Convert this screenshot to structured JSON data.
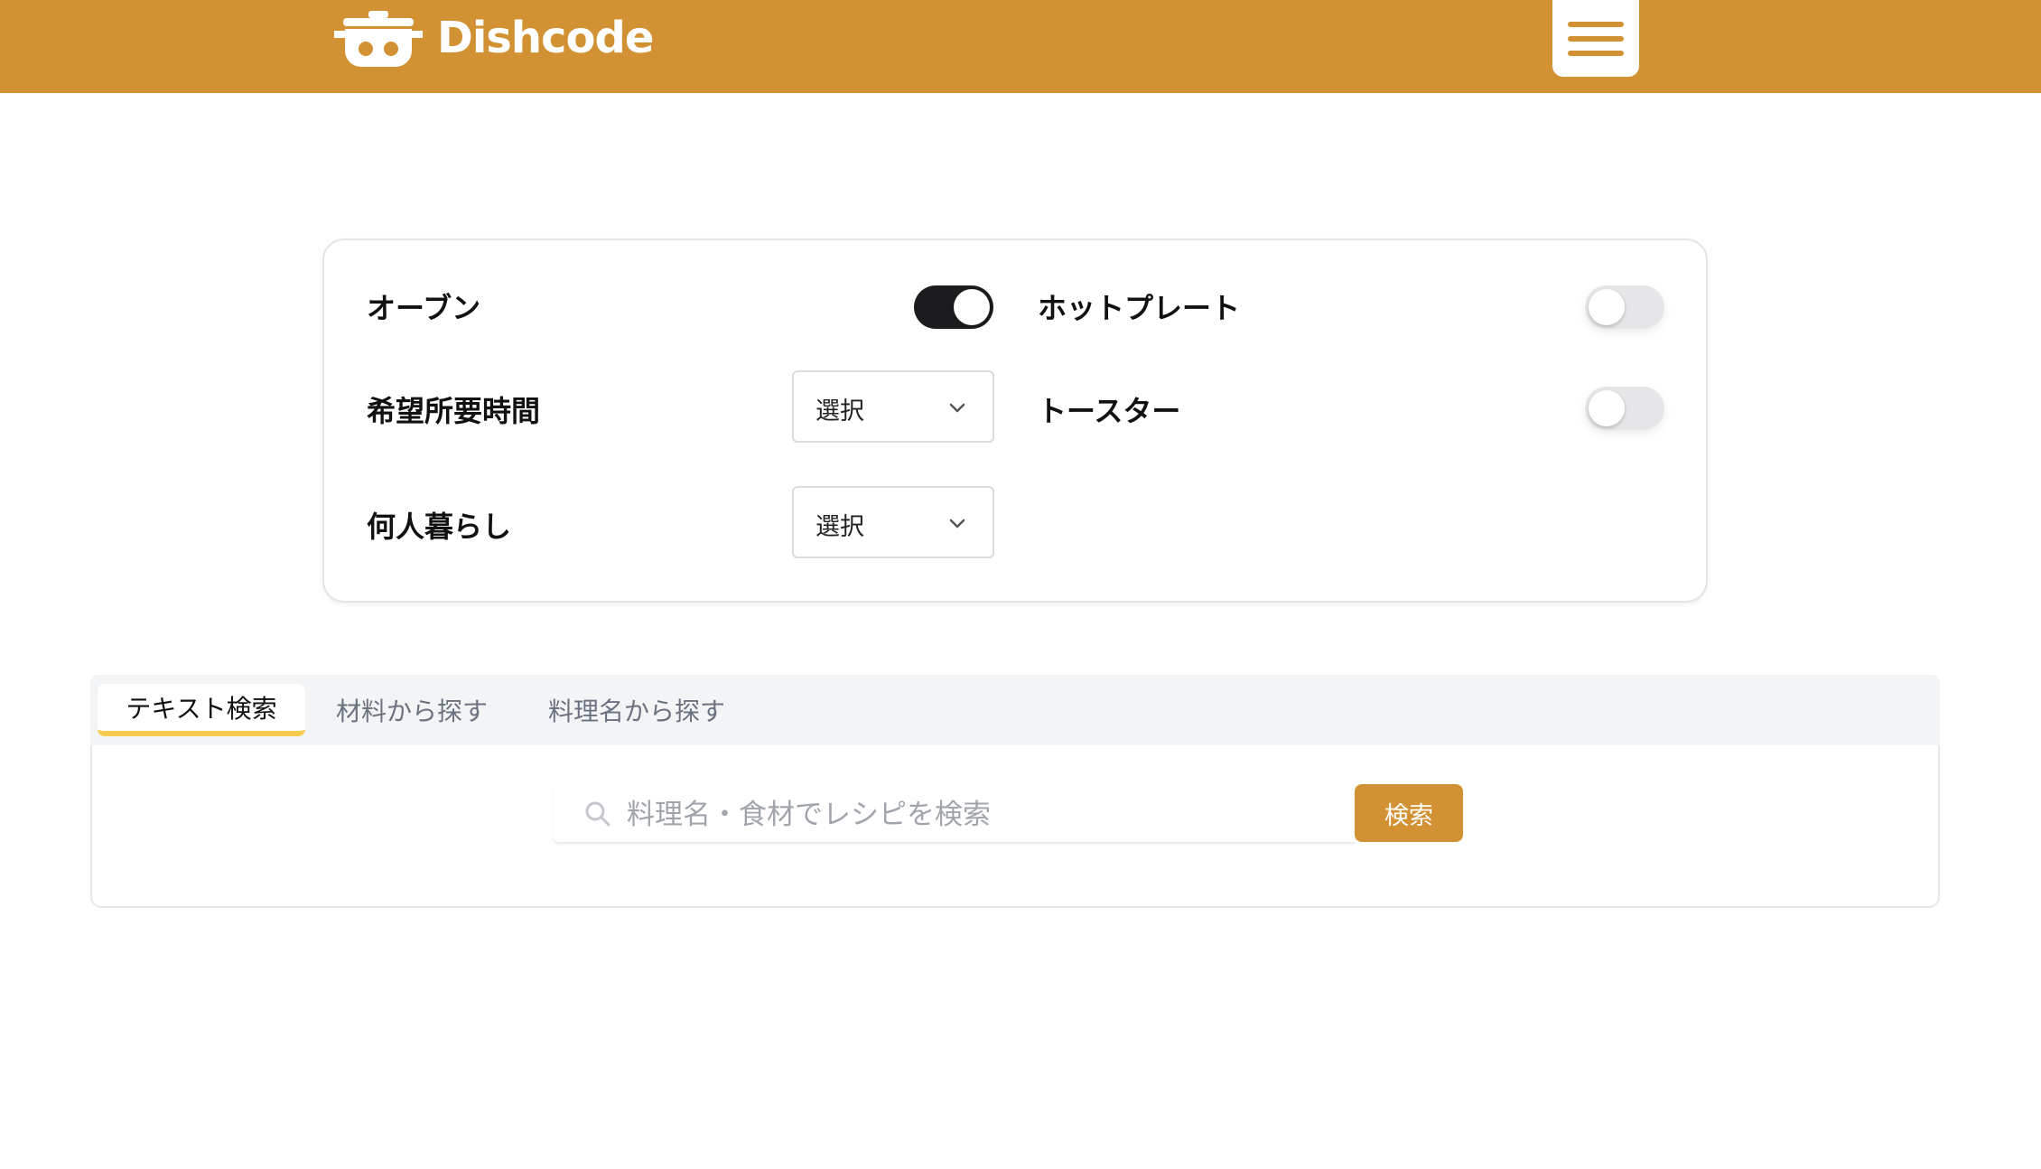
{
  "header": {
    "brand": "Dishcode",
    "brand_color": "#D29233",
    "logo_icon": "pot-icon",
    "menu_icon": "hamburger-menu-icon"
  },
  "filters": {
    "oven": {
      "label": "オーブン",
      "on": true
    },
    "hotplate": {
      "label": "ホットプレート",
      "on": false
    },
    "time": {
      "label": "希望所要時間",
      "value": "選択"
    },
    "toaster": {
      "label": "トースター",
      "on": false
    },
    "household": {
      "label": "何人暮らし",
      "value": "選択"
    }
  },
  "tabs": [
    {
      "label": "テキスト検索",
      "active": true
    },
    {
      "label": "材料から探す",
      "active": false
    },
    {
      "label": "料理名から探す",
      "active": false
    }
  ],
  "search": {
    "placeholder": "料理名・食材でレシピを検索",
    "value": "",
    "button_label": "検索",
    "icon": "search-icon"
  },
  "colors": {
    "accent": "#D29233",
    "tab_underline": "#F7CB4D",
    "toggle_on": "#1c1c1e",
    "toggle_off": "#e6e6e8"
  }
}
